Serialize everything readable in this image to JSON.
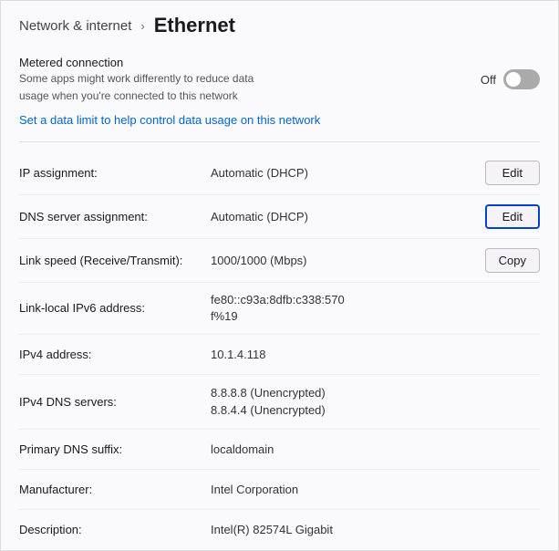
{
  "header": {
    "breadcrumb": "Network & internet",
    "chevron": "›",
    "title": "Ethernet"
  },
  "metered": {
    "title": "Metered connection",
    "description_line1": "Some apps might work differently to reduce data",
    "description_line2": "usage when you're connected to this network",
    "toggle_label": "Off",
    "toggle_state": false
  },
  "data_limit_link": "Set a data limit to help control data usage on this network",
  "settings": [
    {
      "label": "IP assignment:",
      "value": "Automatic (DHCP)",
      "action": "edit",
      "action_label": "Edit",
      "focused": false
    },
    {
      "label": "DNS server assignment:",
      "value": "Automatic (DHCP)",
      "action": "edit",
      "action_label": "Edit",
      "focused": true
    },
    {
      "label": "Link speed (Receive/Transmit):",
      "value": "1000/1000 (Mbps)",
      "action": "copy",
      "action_label": "Copy",
      "focused": false
    },
    {
      "label": "Link-local IPv6 address:",
      "value_line1": "fe80::c93a:8dfb:c338:570",
      "value_line2": "f%19",
      "action": null,
      "focused": false
    },
    {
      "label": "IPv4 address:",
      "value": "10.1.4.118",
      "action": null,
      "focused": false
    },
    {
      "label": "IPv4 DNS servers:",
      "value_line1": "8.8.8.8 (Unencrypted)",
      "value_line2": "8.8.4.4 (Unencrypted)",
      "action": null,
      "focused": false
    },
    {
      "label": "Primary DNS suffix:",
      "value": "localdomain",
      "action": null,
      "focused": false
    },
    {
      "label": "Manufacturer:",
      "value": "Intel Corporation",
      "action": null,
      "focused": false
    },
    {
      "label": "Description:",
      "value": "Intel(R) 82574L Gigabit",
      "action": null,
      "focused": false
    }
  ],
  "buttons": {
    "edit_label": "Edit",
    "copy_label": "Copy"
  }
}
